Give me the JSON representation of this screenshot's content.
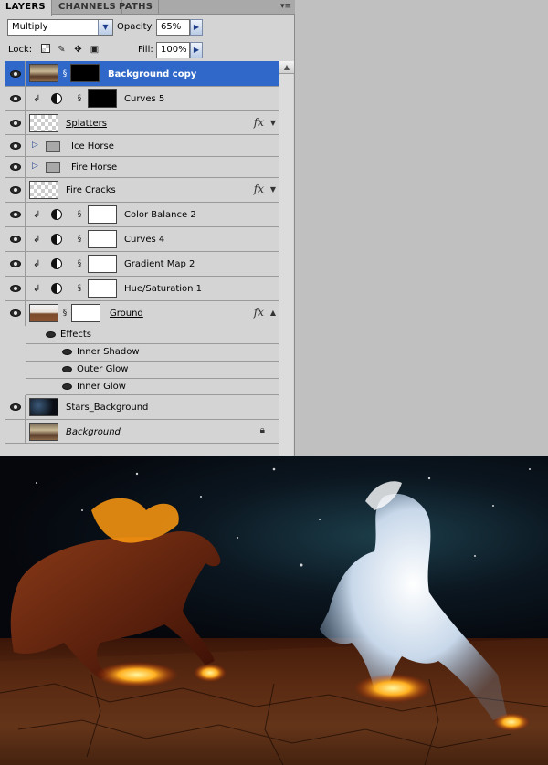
{
  "tabs": [
    {
      "label": "LAYERS",
      "active": true
    },
    {
      "label": "CHANNELS",
      "active": false
    },
    {
      "label": "PATHS",
      "active": false
    }
  ],
  "panel_menu_icon": "panel-menu-icon",
  "blend_mode": "Multiply",
  "opacity": {
    "label": "Opacity:",
    "value": "65%"
  },
  "lock": {
    "label": "Lock:",
    "icons": [
      "lock-transparent-icon",
      "lock-paint-icon",
      "lock-move-icon",
      "lock-all-icon"
    ]
  },
  "fill": {
    "label": "Fill:",
    "value": "100%"
  },
  "layers": [
    {
      "name": "Background copy",
      "selected": true,
      "visible": true,
      "thumb": "photo",
      "mask": "blackmask"
    },
    {
      "name": "Curves 5",
      "visible": true,
      "clipped": true,
      "adjustment": true,
      "mask": "blackmask"
    },
    {
      "name": "Splatters",
      "visible": true,
      "thumb": "checker",
      "fx": true
    },
    {
      "name": "Ice Horse",
      "visible": true,
      "group": true
    },
    {
      "name": "Fire Horse",
      "visible": true,
      "group": true
    },
    {
      "name": "Fire Cracks",
      "visible": true,
      "thumb": "checker",
      "fx": true
    },
    {
      "name": "Color Balance 2",
      "visible": true,
      "clipped": true,
      "adjustment": true,
      "mask": "whitemask"
    },
    {
      "name": "Curves 4",
      "visible": true,
      "clipped": true,
      "adjustment": true,
      "mask": "whitemask"
    },
    {
      "name": "Gradient Map 2",
      "visible": true,
      "clipped": true,
      "adjustment": true,
      "mask": "whitemask"
    },
    {
      "name": "Hue/Saturation 1",
      "visible": true,
      "clipped": true,
      "adjustment": true,
      "mask": "whitemask"
    },
    {
      "name": "Ground",
      "visible": true,
      "thumb": "ground",
      "mask": "whitemask",
      "fx": true
    },
    {
      "name": "Stars_Background",
      "visible": true,
      "thumb": "stars"
    },
    {
      "name": "Background",
      "visible": false,
      "thumb": "photo",
      "locked": true
    }
  ],
  "effects": {
    "label": "Effects",
    "items": [
      "Inner Shadow",
      "Outer Glow",
      "Inner Glow"
    ]
  },
  "fx_label": "fx",
  "icons": {
    "eye": "eye-icon",
    "chain": "link-icon",
    "clip": "clip-arrow-icon",
    "adjustment": "adjustment-layer-icon",
    "folder": "folder-icon",
    "expand": "expand-triangle-icon",
    "lock": "lock-icon",
    "fx_menu": "chevron-down-icon",
    "scroll_up": "scroll-up-arrow-icon"
  }
}
